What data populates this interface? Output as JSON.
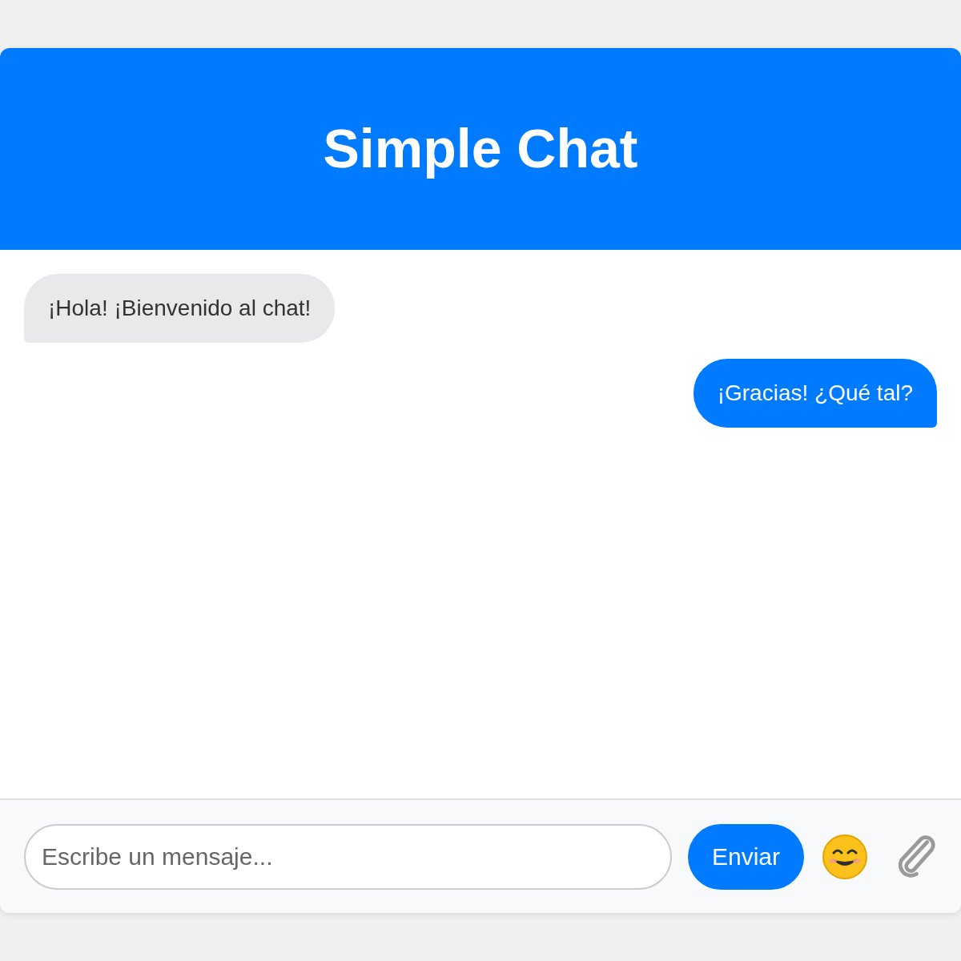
{
  "header": {
    "title": "Simple Chat"
  },
  "messages": [
    {
      "kind": "received",
      "text": "¡Hola! ¡Bienvenido al chat!"
    },
    {
      "kind": "sent",
      "text": "¡Gracias! ¿Qué tal?"
    }
  ],
  "composer": {
    "placeholder": "Escribe un mensaje...",
    "send_label": "Enviar"
  }
}
